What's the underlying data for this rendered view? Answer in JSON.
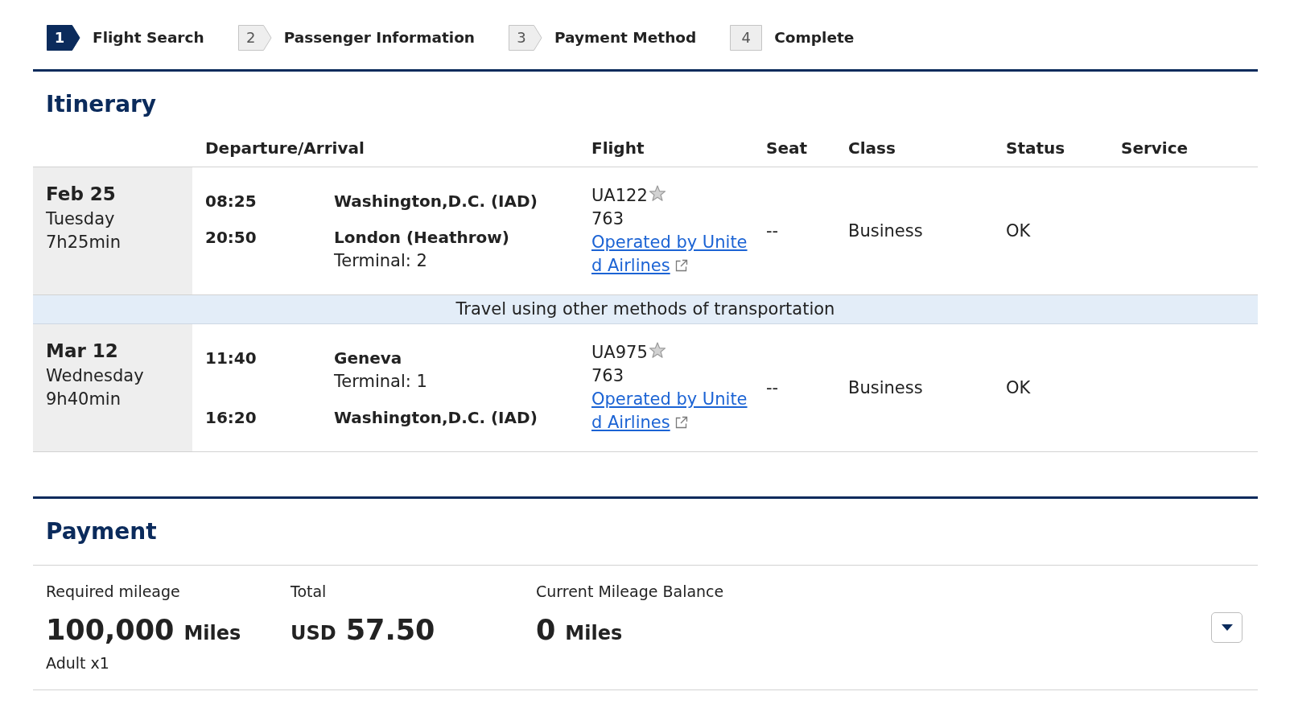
{
  "steps": [
    {
      "number": "1",
      "label": "Flight Search",
      "selected": true
    },
    {
      "number": "2",
      "label": "Passenger Information",
      "selected": false
    },
    {
      "number": "3",
      "label": "Payment Method",
      "selected": false
    },
    {
      "number": "4",
      "label": "Complete",
      "selected": false
    }
  ],
  "itinerary": {
    "title": "Itinerary",
    "columns": [
      "Departure/Arrival",
      "Flight",
      "Seat",
      "Class",
      "Status",
      "Service"
    ],
    "rows": [
      {
        "kind": "segment",
        "date": "Feb 25",
        "weekday": "Tuesday",
        "duration": "7h25min",
        "stops": [
          {
            "time": "08:25",
            "place": "Washington,D.C. (IAD)"
          },
          {
            "time": "20:50",
            "place": "London (Heathrow)",
            "terminal": "Terminal: 2"
          }
        ],
        "flight": "UA122",
        "aircraft": "763",
        "operator_link": "Operated by United Airlines",
        "seat": "--",
        "class": "Business",
        "status": "OK"
      },
      {
        "kind": "notice",
        "text": "Travel using other methods of transportation"
      },
      {
        "kind": "segment",
        "date": "Mar 12",
        "weekday": "Wednesday",
        "duration": "9h40min",
        "stops": [
          {
            "time": "11:40",
            "place": "Geneva",
            "terminal": "Terminal: 1"
          },
          {
            "time": "16:20",
            "place": "Washington,D.C. (IAD)"
          }
        ],
        "flight": "UA975",
        "aircraft": "763",
        "operator_link": "Operated by United Airlines",
        "seat": "--",
        "class": "Business",
        "status": "OK"
      }
    ]
  },
  "payment": {
    "title": "Payment",
    "items": [
      {
        "label": "Required mileage",
        "amount": "100,000",
        "unit": "Miles",
        "note": "Adult x1"
      },
      {
        "label": "Total",
        "currency": "USD",
        "amount": "57.50"
      },
      {
        "label": "Current Mileage Balance",
        "amount": "0",
        "unit": "Miles"
      }
    ]
  }
}
